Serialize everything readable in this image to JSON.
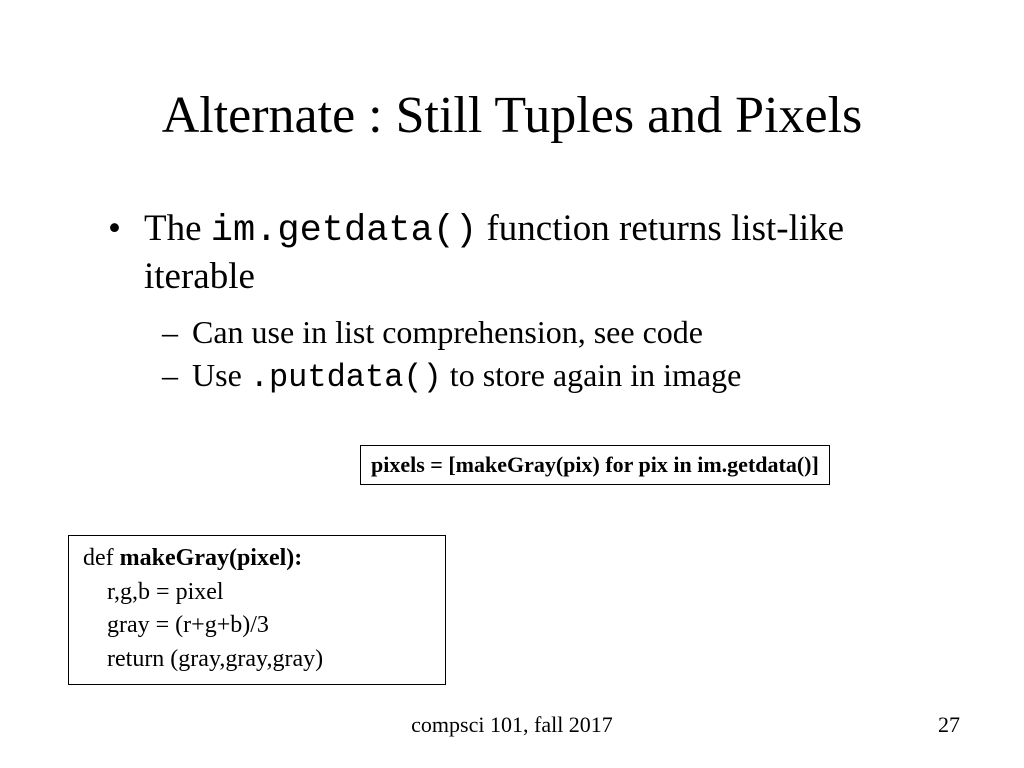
{
  "title": "Alternate : Still Tuples and Pixels",
  "bullets": [
    {
      "pre": "The ",
      "code": "im.getdata()",
      "post": "  function returns list-like iterable",
      "sub": [
        {
          "text": "Can use in list comprehension, see code"
        },
        {
          "pre": "Use ",
          "code": ".putdata()",
          "post": "  to store again in image"
        }
      ]
    }
  ],
  "code_box_1": "pixels = [makeGray(pix) for pix in im.getdata()]",
  "code_box_2": {
    "def_kw": "def",
    "def_sig": "makeGray(pixel):",
    "line1": "r,g,b = pixel",
    "line2": "gray = (r+g+b)/3",
    "line3": "return (gray,gray,gray)"
  },
  "footer": {
    "course": "compsci 101, fall 2017",
    "page": "27"
  }
}
